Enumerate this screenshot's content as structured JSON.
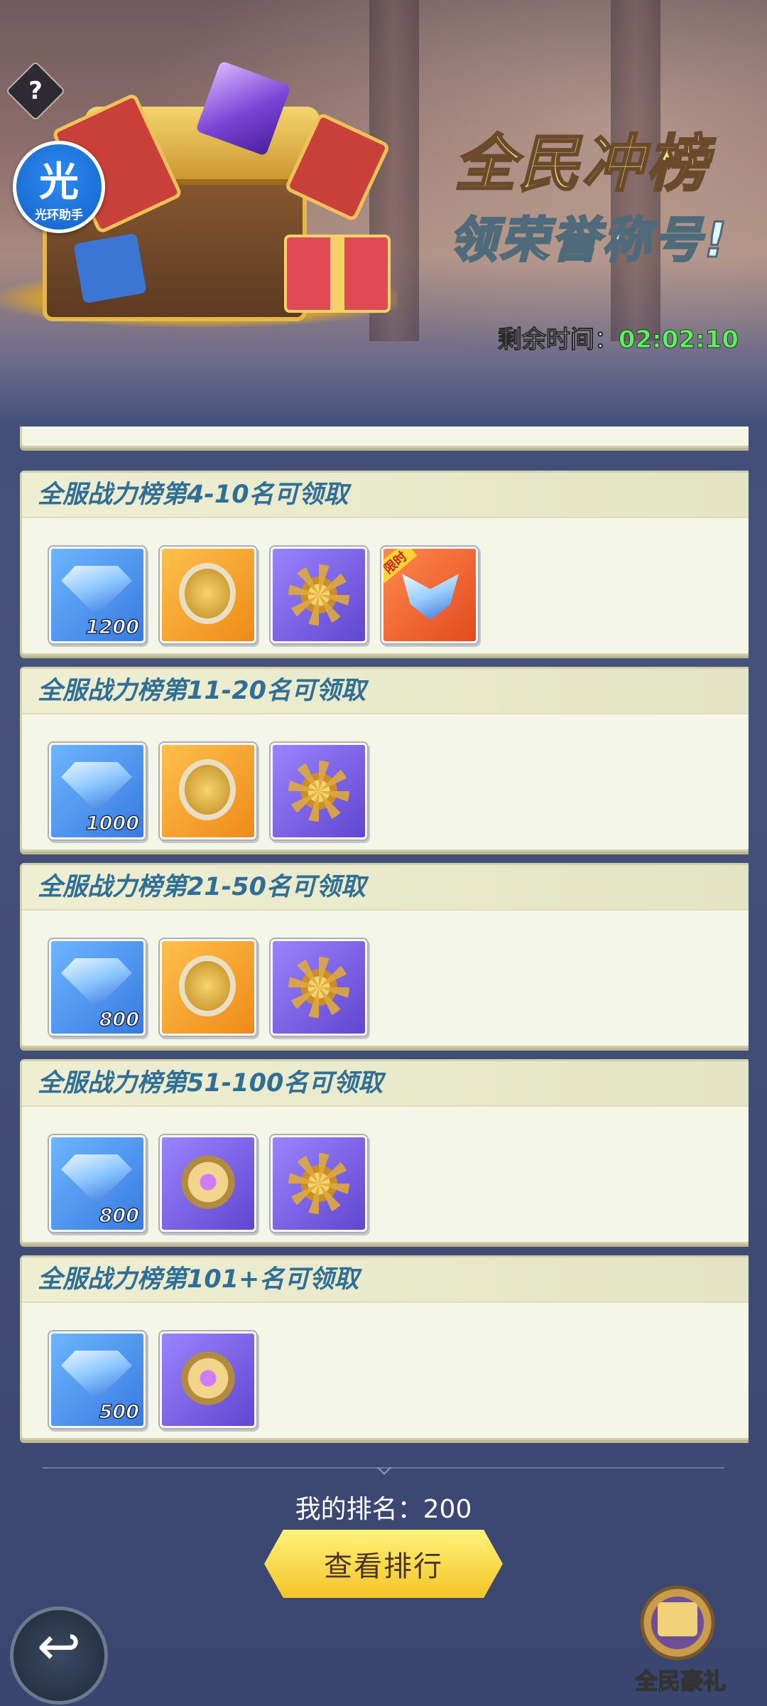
{
  "banner": {
    "title": "全民冲榜",
    "subtitle": "领荣誉称号!",
    "timer_label": "剩余时间：",
    "timer_value": "02:02:10",
    "help_glyph": "?",
    "halo_glyph": "光",
    "halo_label": "光环助手"
  },
  "tiers": [
    {
      "label": "全服战力榜第4-10名可领取",
      "items": [
        {
          "icon": "diamond-icon",
          "bg": "blue",
          "qty": "1200"
        },
        {
          "icon": "amulet-icon",
          "bg": "orange",
          "qty": ""
        },
        {
          "icon": "sun-badge-icon",
          "bg": "purple",
          "qty": ""
        },
        {
          "icon": "wings-icon",
          "bg": "red",
          "qty": "",
          "tag": "限时"
        }
      ]
    },
    {
      "label": "全服战力榜第11-20名可领取",
      "items": [
        {
          "icon": "diamond-icon",
          "bg": "blue",
          "qty": "1000"
        },
        {
          "icon": "amulet-icon",
          "bg": "orange",
          "qty": ""
        },
        {
          "icon": "sun-badge-icon",
          "bg": "purple",
          "qty": ""
        }
      ]
    },
    {
      "label": "全服战力榜第21-50名可领取",
      "items": [
        {
          "icon": "diamond-icon",
          "bg": "blue",
          "qty": "800"
        },
        {
          "icon": "amulet-icon",
          "bg": "orange",
          "qty": ""
        },
        {
          "icon": "sun-badge-icon",
          "bg": "purple",
          "qty": ""
        }
      ]
    },
    {
      "label": "全服战力榜第51-100名可领取",
      "items": [
        {
          "icon": "diamond-icon",
          "bg": "blue",
          "qty": "800"
        },
        {
          "icon": "medal-icon",
          "bg": "purple",
          "qty": ""
        },
        {
          "icon": "sun-badge-icon",
          "bg": "purple",
          "qty": ""
        }
      ]
    },
    {
      "label": "全服战力榜第101+名可领取",
      "items": [
        {
          "icon": "diamond-icon",
          "bg": "blue",
          "qty": "500"
        },
        {
          "icon": "medal-icon",
          "bg": "purple",
          "qty": ""
        }
      ]
    }
  ],
  "footer": {
    "my_rank_label": "我的排名：",
    "my_rank_value": "200",
    "view_rank_button": "查看排行",
    "back_glyph": "↩",
    "gift_label": "全民豪礼"
  },
  "colors": {
    "tier_title": "#2f6e95",
    "timer_value": "#5cf25c",
    "button_yellow": "#f4c428"
  }
}
